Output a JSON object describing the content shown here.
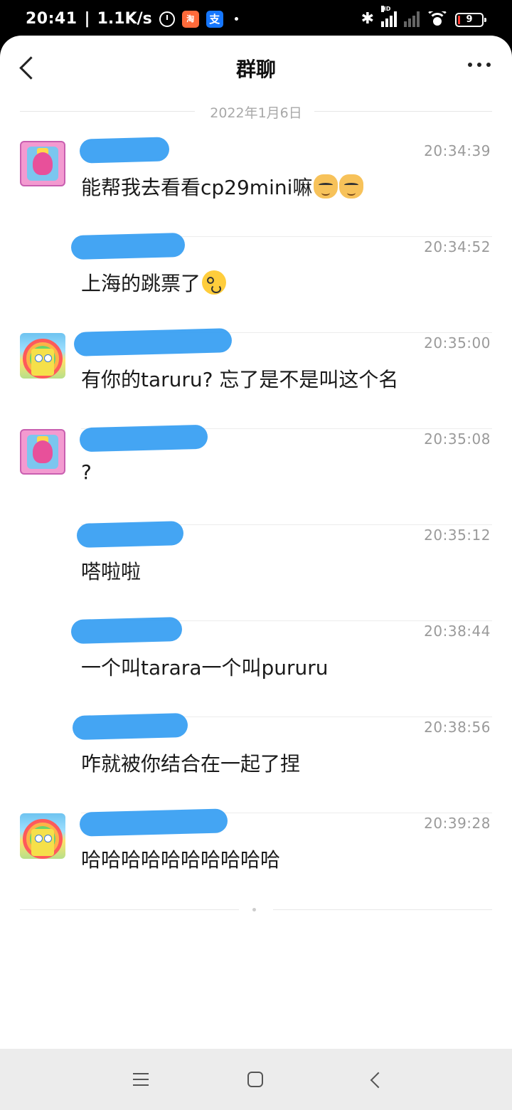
{
  "status_bar": {
    "time": "20:41",
    "network_speed": "1.1K/s",
    "app1_label": "淘",
    "app2_label": "支",
    "signal_label": "HD",
    "battery_level": "9",
    "icons": [
      "alarm-icon",
      "taobao-app-icon",
      "alipay-app-icon",
      "bluetooth-icon",
      "signal-icon",
      "wifi-icon",
      "battery-icon"
    ]
  },
  "header": {
    "title": "群聊"
  },
  "date_divider": "2022年1月6日",
  "messages": [
    {
      "avatar": "pink-character",
      "time": "20:34:39",
      "text": "能帮我去看看cp29mini嘛",
      "emojis": [
        "cat-smirk",
        "cat-smirk"
      ]
    },
    {
      "avatar": "",
      "time": "20:34:52",
      "text": "上海的跳票了",
      "emojis": [
        "zany-face"
      ]
    },
    {
      "avatar": "spongebob-rainbow",
      "time": "20:35:00",
      "text": "有你的taruru? 忘了是不是叫这个名",
      "emojis": []
    },
    {
      "avatar": "pink-character",
      "time": "20:35:08",
      "text": "?",
      "emojis": []
    },
    {
      "avatar": "",
      "time": "20:35:12",
      "text": "嗒啦啦",
      "emojis": []
    },
    {
      "avatar": "",
      "time": "20:38:44",
      "text": "一个叫tarara一个叫pururu",
      "emojis": []
    },
    {
      "avatar": "",
      "time": "20:38:56",
      "text": "咋就被你结合在一起了捏",
      "emojis": []
    },
    {
      "avatar": "spongebob-rainbow",
      "time": "20:39:28",
      "text": "哈哈哈哈哈哈哈哈哈哈",
      "emojis": []
    }
  ],
  "nav_bar": {
    "icons": [
      "menu-icon",
      "home-icon",
      "back-icon"
    ]
  }
}
